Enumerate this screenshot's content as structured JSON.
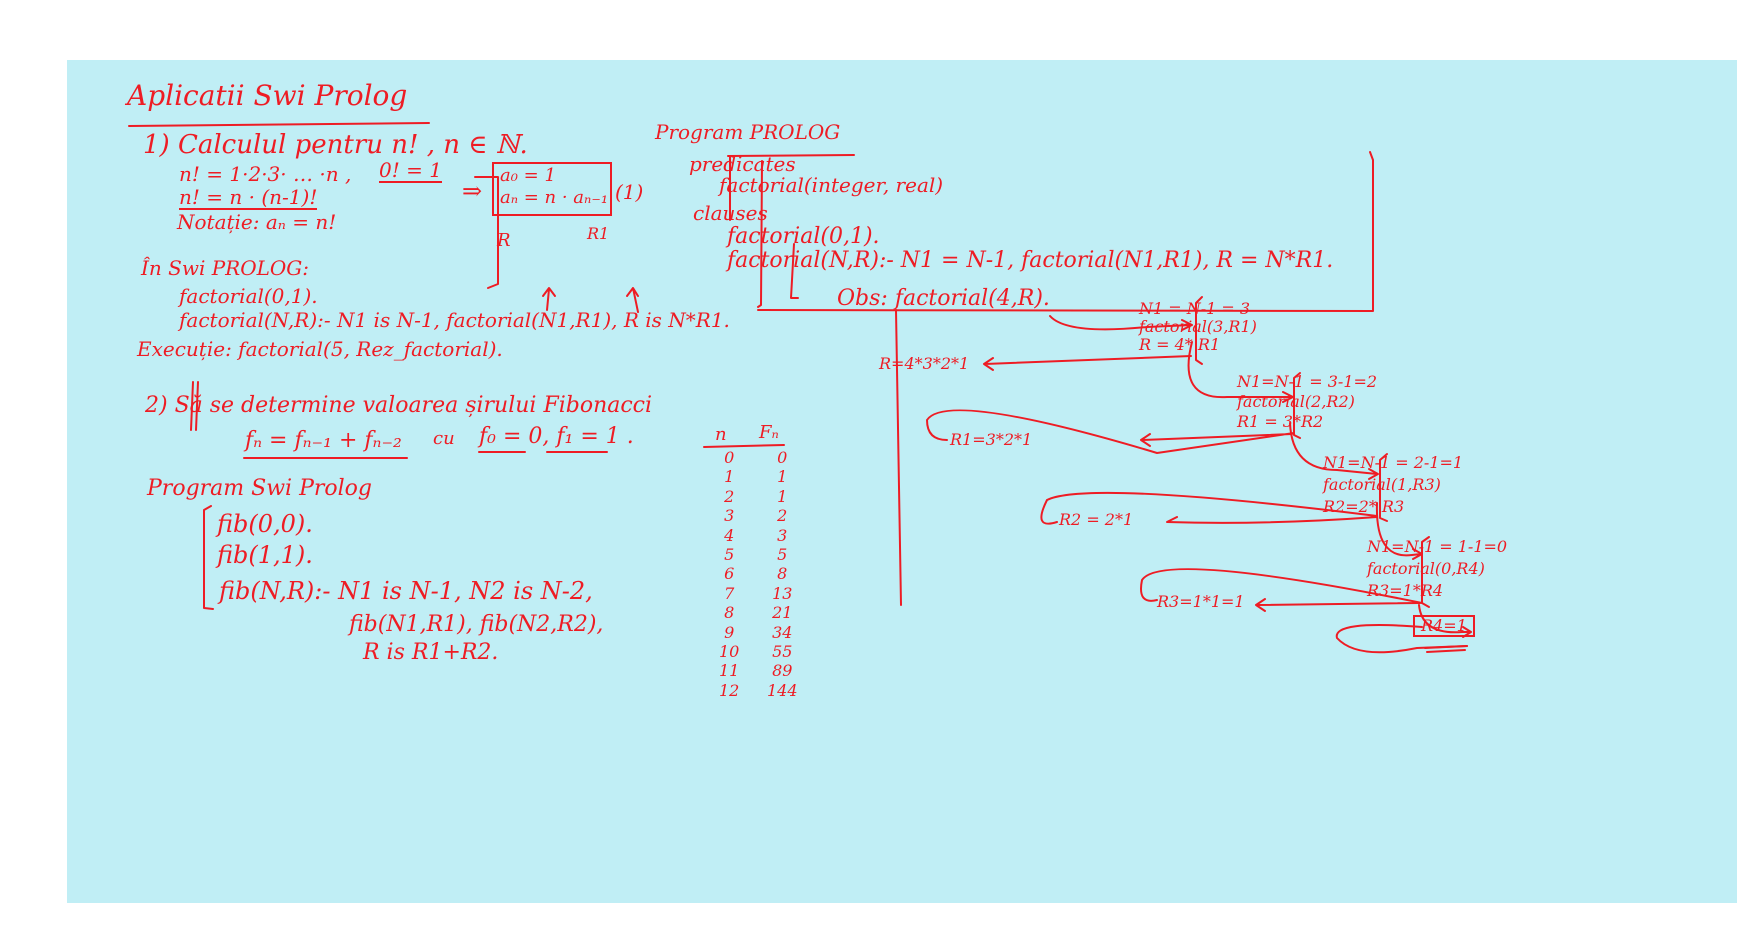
{
  "title": "Aplicatii Swi Prolog",
  "ex1": {
    "heading": "1) Calculul pentru n! , n ∈ ℕ.",
    "line1": "n! = 1·2·3· … ·n ,",
    "zero_fact": "0! = 1",
    "line2": "n! = n · (n-1)!",
    "notation": "Notație: aₙ = n!",
    "implies": "⇒",
    "rec1": "a₀ = 1",
    "rec2": "aₙ = n · aₙ₋₁",
    "eq_tag": "(1)",
    "label_r": "R",
    "label_r1": "R1",
    "swi_heading": "În Swi PROLOG:",
    "clause1": "factorial(0,1).",
    "clause2": "factorial(N,R):- N1 is N-1, factorial(N1,R1), R is N*R1.",
    "exec": "Execuție: factorial(5, Rez_factorial)."
  },
  "prolog_program": {
    "heading": "Program PROLOG",
    "predicates": "predicates",
    "pred_decl": "factorial(integer, real)",
    "clauses": "clauses",
    "clause1": "factorial(0,1).",
    "clause2": "factorial(N,R):- N1 = N-1, factorial(N1,R1), R = N*R1."
  },
  "trace": {
    "obs": "Obs: factorial(4,R).",
    "call1": [
      "N1 = N-1 = 3",
      "factorial(3,R1)",
      "R = 4* R1"
    ],
    "result1": "R=4*3*2*1",
    "call2": [
      "N1=N-1 = 3-1=2",
      "factorial(2,R2)",
      "R1 = 3*R2"
    ],
    "result2": "R1=3*2*1",
    "call3": [
      "N1=N-1 = 2-1=1",
      "factorial(1,R3)",
      "R2=2* R3"
    ],
    "result3": "R2 = 2*1",
    "call4": [
      "N1=N-1 = 1-1=0",
      "factorial(0,R4)",
      "R3=1*R4"
    ],
    "result4": "R3=1*1=1",
    "base": "R4=1"
  },
  "ex2": {
    "heading": "2) Să se determine valoarea șirului Fibonacci",
    "recurrence": "fₙ = fₙ₋₁ + fₙ₋₂",
    "with": "cu",
    "initial": "f₀ = 0, f₁ = 1 .",
    "program_heading": "Program Swi Prolog",
    "clause1": "fib(0,0).",
    "clause2": "fib(1,1).",
    "clause3": "fib(N,R):- N1 is N-1, N2 is N-2,",
    "clause3b": "fib(N1,R1), fib(N2,R2),",
    "clause3c": "R is R1+R2."
  },
  "fib_table": {
    "header_n": "n",
    "header_f": "Fₙ",
    "n": [
      "0",
      "1",
      "2",
      "3",
      "4",
      "5",
      "6",
      "7",
      "8",
      "9",
      "10",
      "11",
      "12"
    ],
    "f": [
      "0",
      "1",
      "1",
      "2",
      "3",
      "5",
      "8",
      "13",
      "21",
      "34",
      "55",
      "89",
      "144"
    ]
  },
  "colors": {
    "ink": "#ee1c24",
    "board": "#c0eef5",
    "page": "#ffffff"
  }
}
